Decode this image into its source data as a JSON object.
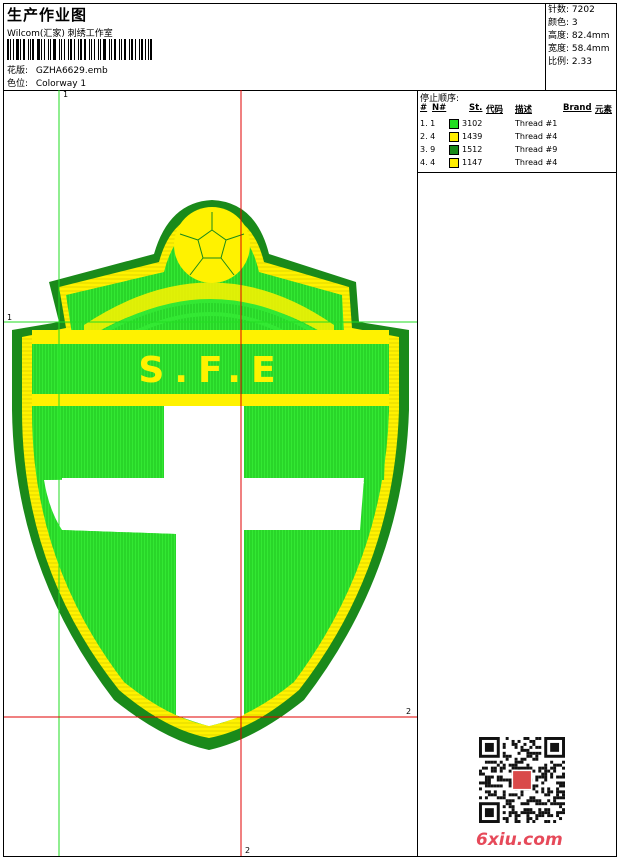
{
  "header": {
    "title": "生产作业图",
    "subtitle": "Wilcom(汇家) 刺绣工作室",
    "design_label": "花版:",
    "design_value": "GZHA6629.emb",
    "colorway_label": "色位:",
    "colorway_value": "Colorway 1"
  },
  "specs": {
    "stitches": "针数: 7202",
    "colors": "颜色: 3",
    "height": "高度: 82.4mm",
    "width": "宽度: 58.4mm",
    "scale": "比例: 2.33"
  },
  "stop_sequence": {
    "caption": "停止顺序:",
    "columns": {
      "num": "#",
      "n": "N#",
      "st": "St.",
      "code": "代码",
      "desc": "描述",
      "brand": "Brand",
      "elem": "元素"
    },
    "rows": [
      {
        "idx": "1. 1",
        "color": "#22dd22",
        "stitches": "3102",
        "desc": "Thread #1"
      },
      {
        "idx": "2. 4",
        "color": "#ffee00",
        "stitches": "1439",
        "desc": "Thread #4"
      },
      {
        "idx": "3. 9",
        "color": "#1a8a1a",
        "stitches": "1512",
        "desc": "Thread #9"
      },
      {
        "idx": "4. 4",
        "color": "#ffee00",
        "stitches": "1147",
        "desc": "Thread #4"
      }
    ]
  },
  "design": {
    "text": "S.F.E",
    "colors": {
      "green": "#22dd22",
      "yellow": "#ffee00",
      "dark_green": "#1a8a1a"
    }
  },
  "guides": {
    "top_mark": "1",
    "left_mark": "1",
    "right_mark": "2",
    "bottom_mark": "2"
  },
  "watermark": "6xiu.com"
}
